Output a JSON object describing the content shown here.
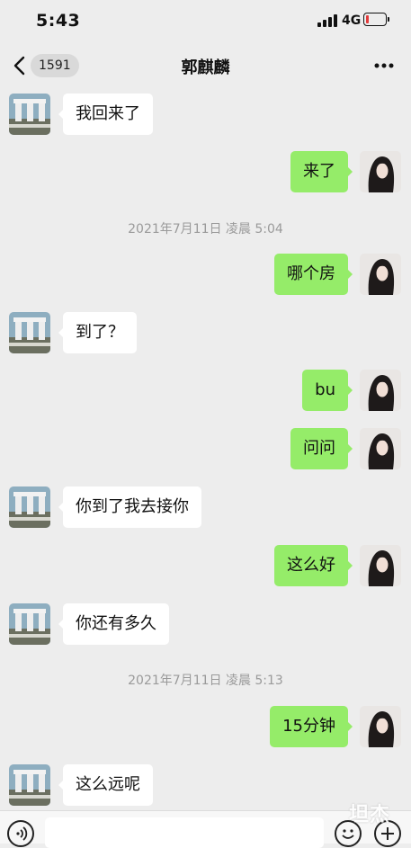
{
  "status_bar": {
    "time": "5:43",
    "network": "4G"
  },
  "nav": {
    "unread_count": "1591",
    "title": "郭麒麟"
  },
  "colors": {
    "sent_bubble": "#95ec69",
    "received_bubble": "#ffffff",
    "background": "#ededed"
  },
  "messages": [
    {
      "side": "left",
      "text": "我回来了"
    },
    {
      "side": "right",
      "text": "来了"
    },
    {
      "timestamp": "2021年7月11日 凌晨 5:04"
    },
    {
      "side": "right",
      "text": "哪个房"
    },
    {
      "side": "left",
      "text": "到了？"
    },
    {
      "side": "right",
      "text": "bu"
    },
    {
      "side": "right",
      "text": "问问"
    },
    {
      "side": "left",
      "text": "你到了我去接你"
    },
    {
      "side": "right",
      "text": "这么好"
    },
    {
      "side": "left",
      "text": "你还有多久"
    },
    {
      "timestamp": "2021年7月11日 凌晨 5:13"
    },
    {
      "side": "right",
      "text": "15分钟"
    },
    {
      "side": "left",
      "text": "这么远呢"
    }
  ],
  "input_bar": {
    "icons": [
      "voice-icon",
      "emoji-icon",
      "plus-icon"
    ]
  },
  "watermark": "坦杰"
}
